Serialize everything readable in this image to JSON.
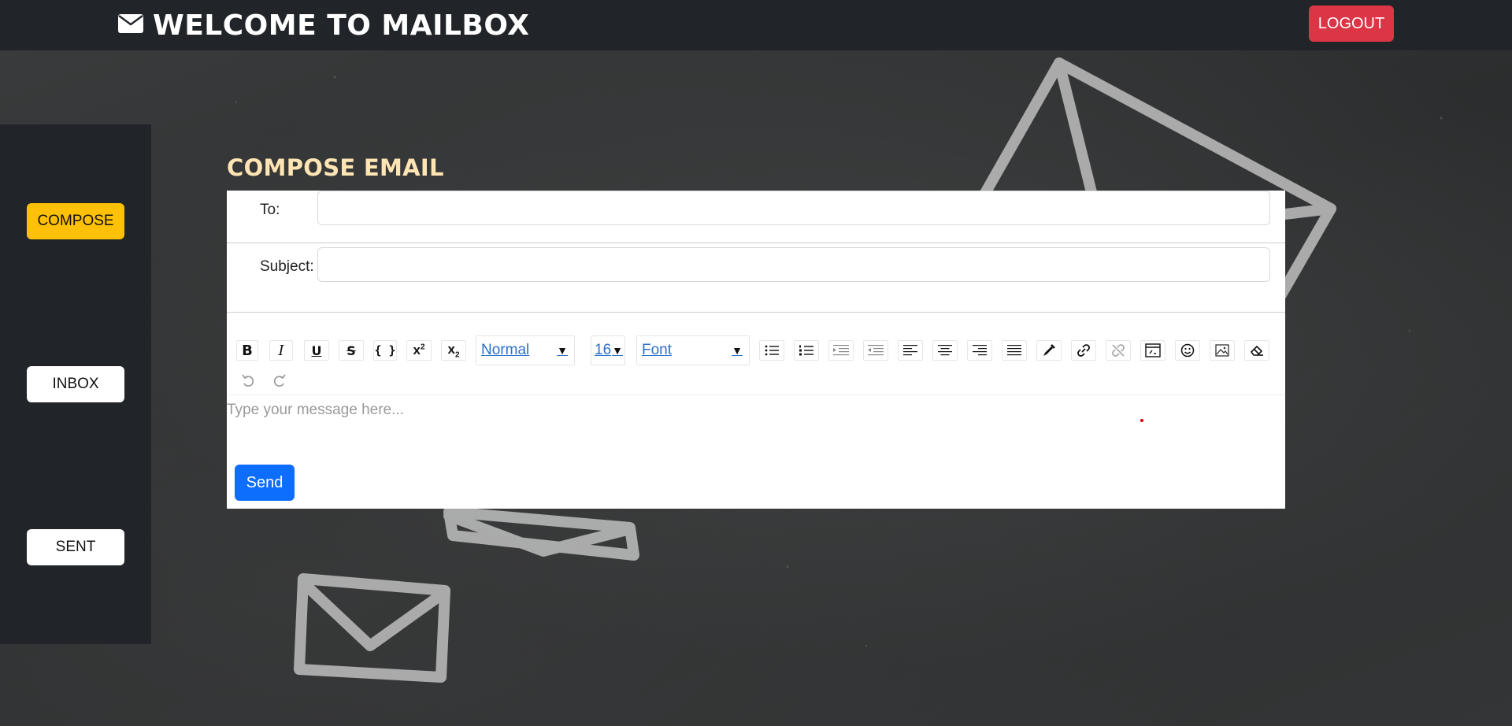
{
  "header": {
    "title": "WELCOME TO MAILBOX",
    "logout_label": "LOGOUT",
    "brand_icon": "envelope-icon"
  },
  "sidebar": {
    "items": [
      {
        "label": "COMPOSE",
        "active": true
      },
      {
        "label": "INBOX",
        "active": false
      },
      {
        "label": "SENT",
        "active": false
      }
    ]
  },
  "compose": {
    "title": "COMPOSE EMAIL",
    "to_label": "To:",
    "to_value": "",
    "subject_label": "Subject:",
    "subject_value": "",
    "body_placeholder": "Type your message here...",
    "send_label": "Send"
  },
  "toolbar": {
    "block_type": "Normal",
    "font_size": "16",
    "font_family": "Font",
    "buttons": [
      "bold-icon",
      "italic-icon",
      "underline-icon",
      "strikethrough-icon",
      "code-icon",
      "superscript-icon",
      "subscript-icon",
      "unordered-list-icon",
      "ordered-list-icon",
      "indent-icon",
      "outdent-icon",
      "align-left-icon",
      "align-center-icon",
      "align-right-icon",
      "align-justify-icon",
      "color-picker-icon",
      "link-icon",
      "unlink-icon",
      "embed-icon",
      "emoji-icon",
      "image-icon",
      "eraser-icon",
      "undo-icon",
      "redo-icon"
    ]
  },
  "colors": {
    "topbar": "#212529",
    "logout": "#dc3545",
    "compose_active": "#ffc107",
    "send": "#0d6efd",
    "title": "#ffe5b4"
  }
}
